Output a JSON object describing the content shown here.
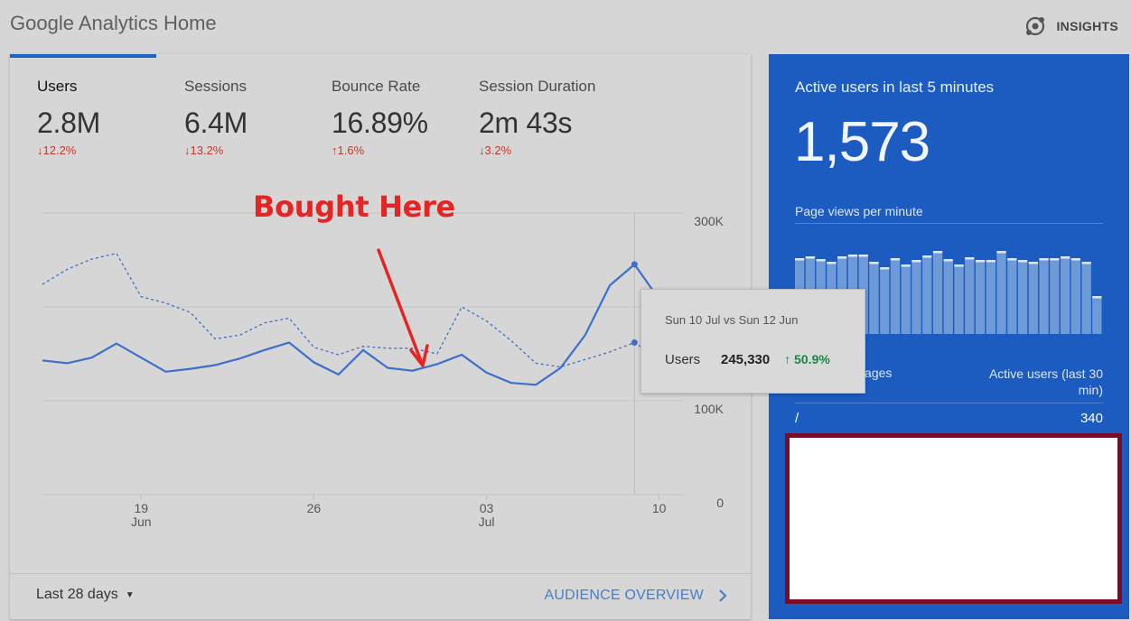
{
  "app": {
    "title": "Google Analytics Home",
    "insights_label": "INSIGHTS"
  },
  "metrics": [
    {
      "label": "Users",
      "value": "2.8M",
      "change": "12.2%",
      "direction": "down"
    },
    {
      "label": "Sessions",
      "value": "6.4M",
      "change": "13.2%",
      "direction": "down"
    },
    {
      "label": "Bounce Rate",
      "value": "16.89%",
      "change": "1.6%",
      "direction": "up"
    },
    {
      "label": "Session Duration",
      "value": "2m 43s",
      "change": "3.2%",
      "direction": "down"
    }
  ],
  "annotation": {
    "text": "Bought Here",
    "color": "#e52424"
  },
  "chart_data": {
    "type": "line",
    "y_ticks": [
      "300K",
      "100K",
      "0"
    ],
    "ylim": [
      0,
      300000
    ],
    "x_ticks": [
      {
        "day": "19",
        "month": "Jun"
      },
      {
        "day": "26",
        "month": ""
      },
      {
        "day": "03",
        "month": "Jul"
      },
      {
        "day": "10",
        "month": ""
      }
    ],
    "series": [
      {
        "line": "solid",
        "values": [
          143000,
          140000,
          146000,
          161000,
          146000,
          131000,
          134000,
          138000,
          145000,
          154000,
          162000,
          141000,
          128000,
          154000,
          135000,
          132000,
          139000,
          149000,
          130000,
          119000,
          117000,
          135000,
          170000,
          223000,
          245330,
          208000,
          166000
        ]
      },
      {
        "line": "dashed",
        "values": [
          224000,
          240000,
          251000,
          257000,
          211000,
          204000,
          194000,
          166000,
          170000,
          183000,
          188000,
          157000,
          149000,
          158000,
          156000,
          156000,
          150000,
          200000,
          185000,
          164000,
          140000,
          136000,
          144000,
          152000,
          162000,
          145000,
          137000
        ]
      }
    ],
    "highlight_index": 24,
    "accent": "#3e6fc9"
  },
  "tooltip": {
    "date": "Sun 10 Jul vs Sun 12 Jun",
    "metric": "Users",
    "value": "245,330",
    "change": "50.9%"
  },
  "footer": {
    "date_range": "Last 28 days",
    "audience_link": "AUDIENCE OVERVIEW"
  },
  "realtime": {
    "title": "Active users in last 5 minutes",
    "count": "1,573",
    "page_views_label": "Page views per minute",
    "page_views": [
      84,
      86,
      83,
      80,
      86,
      88,
      88,
      80,
      74,
      84,
      77,
      82,
      87,
      92,
      83,
      77,
      85,
      82,
      82,
      92,
      84,
      82,
      80,
      84,
      84,
      86,
      84,
      80,
      42
    ],
    "top_pages_header": "Top Active Pages",
    "active_users_header": "Active users (last 30 min)",
    "top_pages": [
      {
        "page": "/",
        "users": "340"
      }
    ],
    "color": "#1c5cc0"
  }
}
